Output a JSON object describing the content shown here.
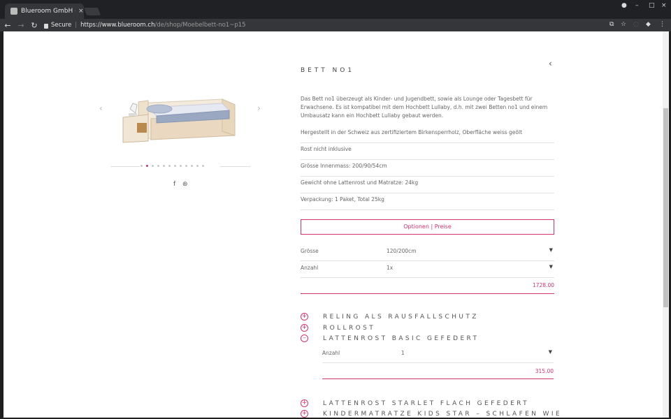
{
  "browser": {
    "tab_title": "Blueroom GmbH - E",
    "tab_close": "×",
    "url_secure": "Secure",
    "url_host": "https://www.blueroom.ch",
    "url_path": "/de/shop/Moebelbett-no1~p15"
  },
  "product": {
    "title": "BETT NO1",
    "description": "Das Bett no1 überzeugt als Kinder- und Jugendbett, sowie als Lounge oder Tagesbett für Erwachsene. Es ist kompatibel mit dem Hochbett Lullaby, d.h. mit zwei Betten no1 und einem Umbausatz kann ein Hochbett Lullaby gebaut werden.",
    "specs": [
      "Hergestellt in der Schweiz aus zertifiziertem Birkensperrholz, Oberfläche weiss geölt",
      "Rost nicht inklusive",
      "Grösse Innenmass: 200/90/54cm",
      "Gewicht ohne Lattenrost und Matratze: 24kg",
      "Verpackung: 1 Paket, Total 25kg"
    ],
    "options_button": "Optionen | Preise",
    "size_label": "Grösse",
    "size_value": "120/200cm",
    "qty_label": "Anzahl",
    "qty_value": "1x",
    "price": "1728.00"
  },
  "accessories": [
    {
      "label": "RELING ALS RAUSFALLSCHUTZ",
      "icon": "plus-circle-icon"
    },
    {
      "label": "ROLLROST",
      "icon": "plus-circle-icon"
    },
    {
      "label": "LATTENROST BASIC GEFEDERT",
      "icon": "minus-circle-icon"
    },
    {
      "label": "LATTENROST STARLET FLACH GEFEDERT",
      "icon": "plus-circle-icon"
    },
    {
      "label": "KINDERMATRATZE KIDS STAR – SCHLAFEN WIE",
      "icon": "plus-circle-icon"
    }
  ],
  "lattenrost": {
    "qty_label": "Anzahl",
    "qty_value": "1",
    "price": "315.00"
  },
  "colors": {
    "accent": "#d6336c",
    "chrome_dark": "#202124",
    "chrome_bar": "#35363a"
  }
}
